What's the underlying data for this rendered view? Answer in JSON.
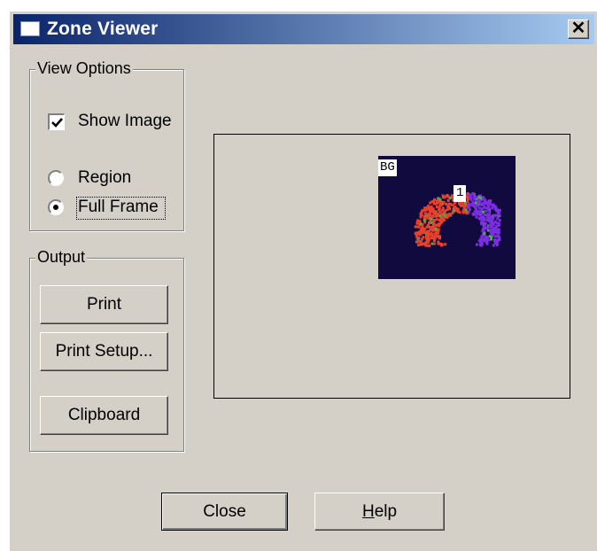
{
  "window": {
    "title": "Zone Viewer",
    "close_glyph": "✕"
  },
  "view_options": {
    "legend": "View Options",
    "show_image": {
      "label": "Show Image",
      "checked": true
    },
    "region": {
      "label": "Region",
      "selected": false
    },
    "full_frame": {
      "label": "Full Frame",
      "selected": true
    }
  },
  "output": {
    "legend": "Output",
    "print_label": "Print",
    "print_setup_label": "Print Setup...",
    "clipboard_label": "Clipboard"
  },
  "preview": {
    "tags": {
      "bg": "BG",
      "zone": "1"
    },
    "colors": {
      "background": "#110a3e",
      "red": "#e8402a",
      "purple": "#7a2ee0",
      "green": "#4caf50"
    }
  },
  "footer": {
    "close_label": "Close",
    "help_label_rest": "elp",
    "help_mnemonic": "H"
  }
}
